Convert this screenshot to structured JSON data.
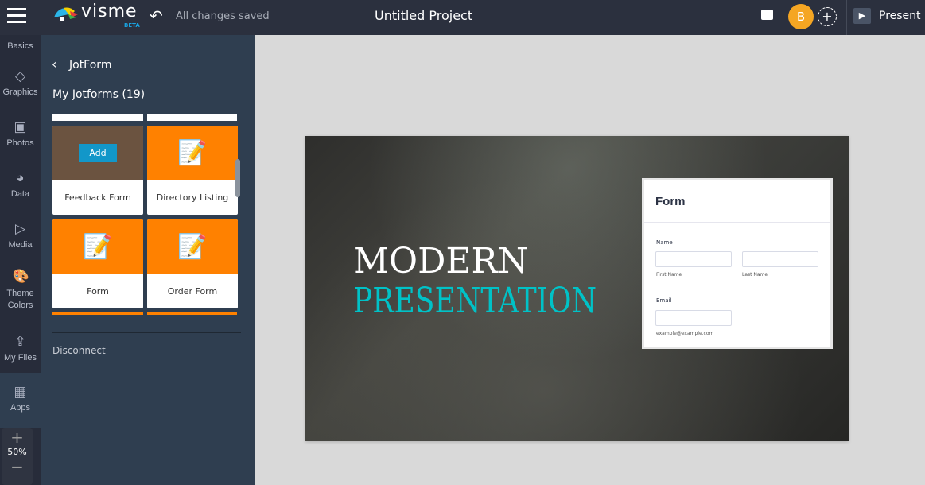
{
  "topbar": {
    "logo": "visme",
    "logo_badge": "BETA",
    "save_status": "All changes saved",
    "project_title": "Untitled Project",
    "avatar_initial": "B",
    "present_label": "Present"
  },
  "rail": {
    "items": [
      {
        "label": "Basics"
      },
      {
        "label": "Graphics"
      },
      {
        "label": "Photos"
      },
      {
        "label": "Data"
      },
      {
        "label": "Media"
      },
      {
        "label": "Theme Colors"
      },
      {
        "label": "My Files"
      },
      {
        "label": "Apps"
      }
    ],
    "zoom": "50%"
  },
  "panel": {
    "title": "JotForm",
    "subtitle": "My Jotforms (19)",
    "add_label": "Add",
    "forms": [
      {
        "name": "Feedback Form"
      },
      {
        "name": "Directory Listing"
      },
      {
        "name": "Form"
      },
      {
        "name": "Order Form"
      }
    ],
    "disconnect": "Disconnect"
  },
  "slide": {
    "line1": "MODERN",
    "line2": "PRESENTATION",
    "form": {
      "title": "Form",
      "name_label": "Name",
      "first_name": "First Name",
      "last_name": "Last Name",
      "email_label": "Email",
      "email_hint": "example@example.com"
    }
  },
  "colors": {
    "accent": "#ff8100",
    "teal": "#00c2c7",
    "topbar": "#2b303e",
    "panel": "#2f3e50"
  }
}
